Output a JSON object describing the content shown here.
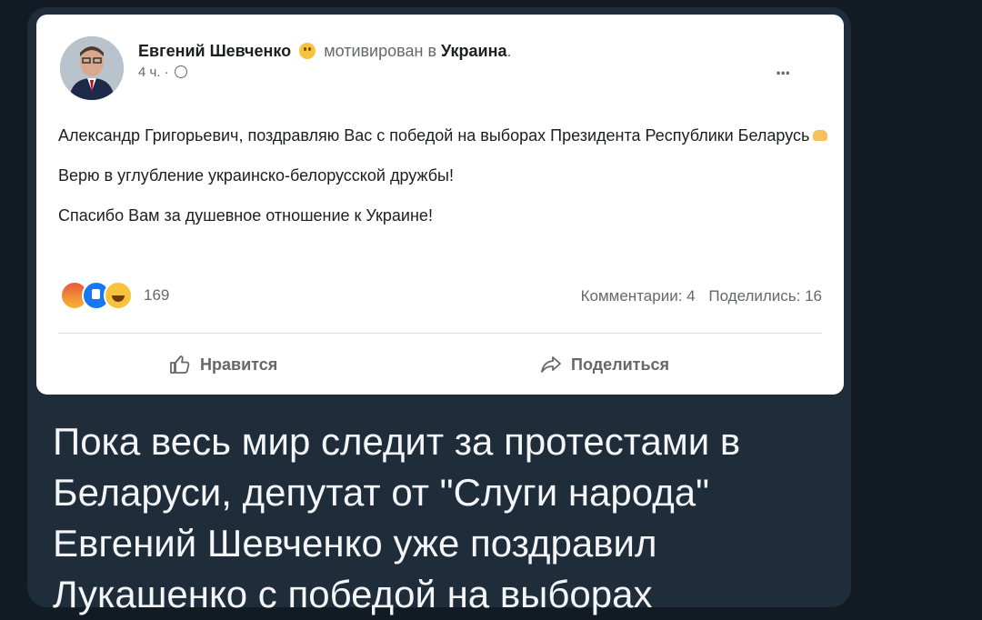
{
  "post": {
    "author": "Евгений Шевченко",
    "activity": "мотивирован в",
    "place": "Украина",
    "time": "4 ч.",
    "separator": "·",
    "more_label": "...",
    "paragraphs": [
      "Александр Григорьевич, поздравляю Вас с победой на  выборах Президента Республики Беларусь",
      "Верю в углубление украинско-белорусской дружбы!",
      "Спасибо Вам за душевное отношение к Украине!"
    ],
    "reaction_icons": [
      "angry-reaction-icon",
      "like-reaction-icon",
      "haha-reaction-icon"
    ],
    "reaction_count": "169",
    "comments": "Комментарии: 4",
    "shares": "Поделились: 16",
    "like_label": "Нравится",
    "share_label": "Поделиться"
  },
  "caption": "Пока весь мир следит за протестами в Беларуси, депутат от \"Слуги народа\" Евгений Шевченко уже поздравил Лукашенко с победой на выборах",
  "colors": {
    "background": "#121a23",
    "bubble": "#1f2c3a",
    "card": "#ffffff",
    "like_blue": "#1877f2"
  }
}
